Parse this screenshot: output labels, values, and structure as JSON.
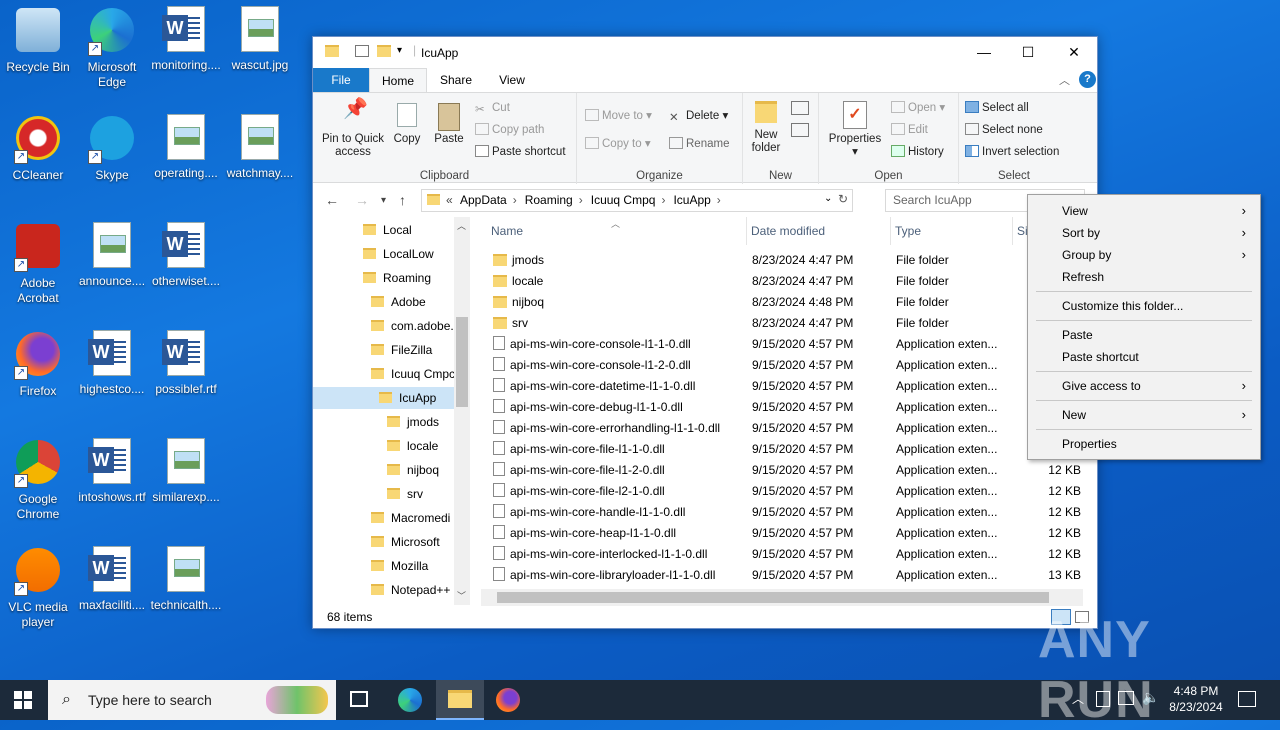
{
  "desktop": {
    "icons": [
      {
        "label": "Recycle Bin",
        "icon": "recycle-bin-icon"
      },
      {
        "label": "Microsoft Edge",
        "icon": "edge-icon"
      },
      {
        "label": "monitoring....",
        "icon": "word-doc-icon"
      },
      {
        "label": "wascut.jpg",
        "icon": "image-file-icon"
      },
      {
        "label": "CCleaner",
        "icon": "ccleaner-icon"
      },
      {
        "label": "Skype",
        "icon": "skype-icon"
      },
      {
        "label": "operating....",
        "icon": "image-file-icon"
      },
      {
        "label": "watchmay....",
        "icon": "image-file-icon"
      },
      {
        "label": "Adobe Acrobat",
        "icon": "acrobat-icon"
      },
      {
        "label": "announce....",
        "icon": "image-file-icon"
      },
      {
        "label": "otherwiset....",
        "icon": "word-doc-icon"
      },
      {
        "label": "Firefox",
        "icon": "firefox-icon"
      },
      {
        "label": "highestco....",
        "icon": "word-doc-icon"
      },
      {
        "label": "possiblef.rtf",
        "icon": "word-doc-icon"
      },
      {
        "label": "Google Chrome",
        "icon": "chrome-icon"
      },
      {
        "label": "intoshows.rtf",
        "icon": "word-doc-icon"
      },
      {
        "label": "similarexp....",
        "icon": "image-file-icon"
      },
      {
        "label": "VLC media player",
        "icon": "vlc-icon"
      },
      {
        "label": "maxfaciliti....",
        "icon": "word-doc-icon"
      },
      {
        "label": "technicalth....",
        "icon": "image-file-icon"
      }
    ]
  },
  "explorer": {
    "title": "IcuApp",
    "controls": {
      "minimize": "—",
      "maximize": "☐",
      "close": "✕"
    },
    "tabs": {
      "file": "File",
      "home": "Home",
      "share": "Share",
      "view": "View"
    },
    "ribbon": {
      "clipboard": {
        "pin": "Pin to Quick access",
        "copy": "Copy",
        "paste": "Paste",
        "cut": "Cut",
        "copy_path": "Copy path",
        "paste_shortcut": "Paste shortcut",
        "label": "Clipboard"
      },
      "organize": {
        "move_to": "Move to",
        "copy_to": "Copy to",
        "delete": "Delete",
        "rename": "Rename",
        "label": "Organize"
      },
      "new": {
        "new_folder": "New folder",
        "label": "New"
      },
      "open": {
        "properties": "Properties",
        "open": "Open",
        "edit": "Edit",
        "history": "History",
        "label": "Open"
      },
      "select": {
        "select_all": "Select all",
        "select_none": "Select none",
        "invert": "Invert selection",
        "label": "Select"
      }
    },
    "address": {
      "prefix": "«",
      "crumbs": [
        "AppData",
        "Roaming",
        "Icuuq Cmpq",
        "IcuApp"
      ],
      "sep": "›"
    },
    "search": {
      "placeholder": "Search IcuApp"
    },
    "tree": [
      {
        "label": "Local",
        "level": 0
      },
      {
        "label": "LocalLow",
        "level": 0
      },
      {
        "label": "Roaming",
        "level": 0
      },
      {
        "label": "Adobe",
        "level": 1
      },
      {
        "label": "com.adobe.",
        "level": 1
      },
      {
        "label": "FileZilla",
        "level": 1
      },
      {
        "label": "Icuuq Cmpc",
        "level": 1
      },
      {
        "label": "IcuApp",
        "level": 2,
        "selected": true
      },
      {
        "label": "jmods",
        "level": 3
      },
      {
        "label": "locale",
        "level": 3
      },
      {
        "label": "nijboq",
        "level": 3
      },
      {
        "label": "srv",
        "level": 3
      },
      {
        "label": "Macromedi",
        "level": 1
      },
      {
        "label": "Microsoft",
        "level": 1
      },
      {
        "label": "Mozilla",
        "level": 1
      },
      {
        "label": "Notepad++",
        "level": 1
      }
    ],
    "columns": {
      "name": "Name",
      "date": "Date modified",
      "type": "Type",
      "size": "Size"
    },
    "files": [
      {
        "name": "jmods",
        "date": "8/23/2024 4:47 PM",
        "type": "File folder",
        "size": "",
        "kind": "folder"
      },
      {
        "name": "locale",
        "date": "8/23/2024 4:47 PM",
        "type": "File folder",
        "size": "",
        "kind": "folder"
      },
      {
        "name": "nijboq",
        "date": "8/23/2024 4:48 PM",
        "type": "File folder",
        "size": "",
        "kind": "folder"
      },
      {
        "name": "srv",
        "date": "8/23/2024 4:47 PM",
        "type": "File folder",
        "size": "",
        "kind": "folder"
      },
      {
        "name": "api-ms-win-core-console-l1-1-0.dll",
        "date": "9/15/2020 4:57 PM",
        "type": "Application exten...",
        "size": "",
        "kind": "dll"
      },
      {
        "name": "api-ms-win-core-console-l1-2-0.dll",
        "date": "9/15/2020 4:57 PM",
        "type": "Application exten...",
        "size": "",
        "kind": "dll"
      },
      {
        "name": "api-ms-win-core-datetime-l1-1-0.dll",
        "date": "9/15/2020 4:57 PM",
        "type": "Application exten...",
        "size": "",
        "kind": "dll"
      },
      {
        "name": "api-ms-win-core-debug-l1-1-0.dll",
        "date": "9/15/2020 4:57 PM",
        "type": "Application exten...",
        "size": "",
        "kind": "dll"
      },
      {
        "name": "api-ms-win-core-errorhandling-l1-1-0.dll",
        "date": "9/15/2020 4:57 PM",
        "type": "Application exten...",
        "size": "",
        "kind": "dll"
      },
      {
        "name": "api-ms-win-core-file-l1-1-0.dll",
        "date": "9/15/2020 4:57 PM",
        "type": "Application exten...",
        "size": "",
        "kind": "dll"
      },
      {
        "name": "api-ms-win-core-file-l1-2-0.dll",
        "date": "9/15/2020 4:57 PM",
        "type": "Application exten...",
        "size": "12 KB",
        "kind": "dll"
      },
      {
        "name": "api-ms-win-core-file-l2-1-0.dll",
        "date": "9/15/2020 4:57 PM",
        "type": "Application exten...",
        "size": "12 KB",
        "kind": "dll"
      },
      {
        "name": "api-ms-win-core-handle-l1-1-0.dll",
        "date": "9/15/2020 4:57 PM",
        "type": "Application exten...",
        "size": "12 KB",
        "kind": "dll"
      },
      {
        "name": "api-ms-win-core-heap-l1-1-0.dll",
        "date": "9/15/2020 4:57 PM",
        "type": "Application exten...",
        "size": "12 KB",
        "kind": "dll"
      },
      {
        "name": "api-ms-win-core-interlocked-l1-1-0.dll",
        "date": "9/15/2020 4:57 PM",
        "type": "Application exten...",
        "size": "12 KB",
        "kind": "dll"
      },
      {
        "name": "api-ms-win-core-libraryloader-l1-1-0.dll",
        "date": "9/15/2020 4:57 PM",
        "type": "Application exten...",
        "size": "13 KB",
        "kind": "dll"
      }
    ],
    "status": "68 items"
  },
  "context_menu": {
    "items": [
      {
        "label": "View",
        "submenu": true
      },
      {
        "label": "Sort by",
        "submenu": true
      },
      {
        "label": "Group by",
        "submenu": true
      },
      {
        "label": "Refresh",
        "submenu": false
      },
      {
        "label": "Customize this folder...",
        "submenu": false
      },
      {
        "label": "Paste",
        "submenu": false
      },
      {
        "label": "Paste shortcut",
        "submenu": false
      },
      {
        "label": "Give access to",
        "submenu": true
      },
      {
        "label": "New",
        "submenu": true
      },
      {
        "label": "Properties",
        "submenu": false
      }
    ]
  },
  "taskbar": {
    "search_placeholder": "Type here to search",
    "time": "4:48 PM",
    "date": "8/23/2024"
  },
  "watermark": "ANY RUN",
  "colors": {
    "desktop": "#0b63c9",
    "accent": "#1979ca",
    "taskbar": "#1c2a3a",
    "folder": "#f8d775"
  }
}
